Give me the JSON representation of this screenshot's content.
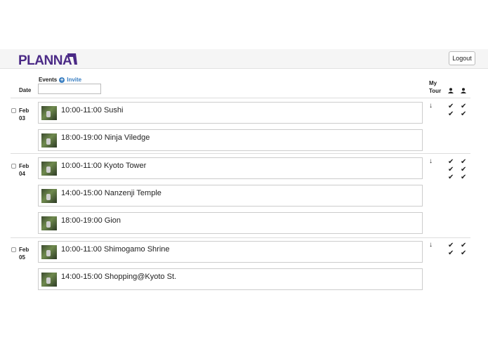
{
  "header": {
    "logo": "PLANNA",
    "logout_label": "Logout"
  },
  "columns": {
    "date": "Date",
    "events": "Events",
    "invite": "Invite",
    "my": "My",
    "tour": "Tour"
  },
  "days": [
    {
      "month": "Feb",
      "day": "03",
      "events": [
        "10:00-11:00 Sushi",
        "18:00-19:00 Ninja Viledge"
      ]
    },
    {
      "month": "Feb",
      "day": "04",
      "events": [
        "10:00-11:00 Kyoto Tower",
        "14:00-15:00 Nanzenji Temple",
        "18:00-19:00 Gion"
      ]
    },
    {
      "month": "Feb",
      "day": "05",
      "events": [
        "10:00-11:00 Shimogamo Shrine",
        "14:00-15:00 Shopping@Kyoto St."
      ]
    }
  ],
  "icons": {
    "arrow": "↓",
    "check": "✔"
  },
  "colors": {
    "brand": "#4b2a86",
    "link": "#3a7fc2"
  }
}
